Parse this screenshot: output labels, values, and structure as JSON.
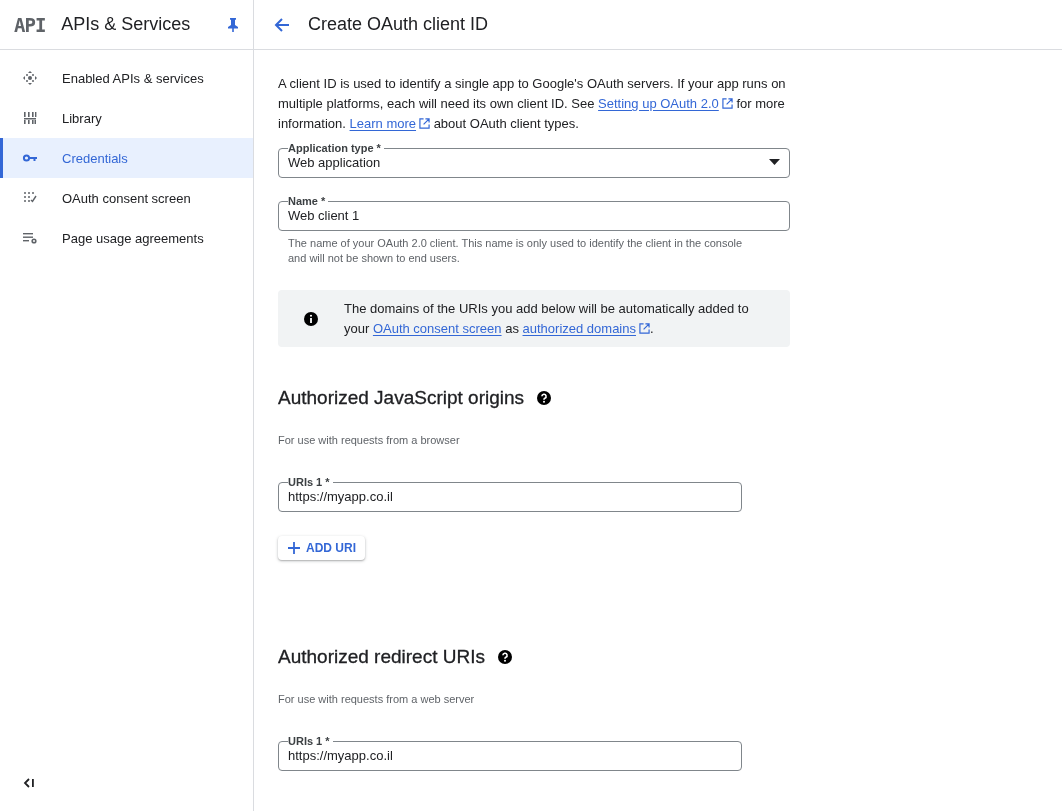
{
  "product": {
    "logo": "API",
    "title": "APIs & Services"
  },
  "sidebar": {
    "items": [
      {
        "label": "Enabled APIs & services",
        "selected": false
      },
      {
        "label": "Library",
        "selected": false
      },
      {
        "label": "Credentials",
        "selected": true
      },
      {
        "label": "OAuth consent screen",
        "selected": false
      },
      {
        "label": "Page usage agreements",
        "selected": false
      }
    ]
  },
  "page": {
    "title": "Create OAuth client ID"
  },
  "intro": [
    {
      "kind": "text",
      "text": "A client ID is used to identify a single app to Google's OAuth servers. If your app runs on multiple platforms, each will need its own client ID. See "
    },
    {
      "kind": "link",
      "text": "Setting up OAuth 2.0",
      "external": true
    },
    {
      "kind": "text",
      "text": " for more information. "
    },
    {
      "kind": "link",
      "text": "Learn more",
      "external": true
    },
    {
      "kind": "text",
      "text": " about OAuth client types."
    }
  ],
  "fields": [
    {
      "kind": "select",
      "label": "Application type *",
      "value": "Web application"
    },
    {
      "kind": "text",
      "label": "Name *",
      "value": "Web client 1",
      "hint": "The name of your OAuth 2.0 client. This name is only used to identify the client in the console and will not be shown to end users."
    }
  ],
  "notice": [
    {
      "kind": "text",
      "text": "The domains of the URIs you add below will be automatically added to your "
    },
    {
      "kind": "link",
      "text": "OAuth consent screen",
      "external": false
    },
    {
      "kind": "text",
      "text": " as "
    },
    {
      "kind": "link",
      "text": "authorized domains",
      "external": true
    },
    {
      "kind": "text",
      "text": "."
    }
  ],
  "sections": [
    {
      "title": "Authorized JavaScript origins",
      "subtitle": "For use with requests from a browser",
      "uris": [
        {
          "label": "URIs 1 *",
          "value": "https://myapp.co.il"
        }
      ],
      "button": "ADD URI"
    },
    {
      "title": "Authorized redirect URIs",
      "subtitle": "For use with requests from a web server",
      "uris": [
        {
          "label": "URIs 1 *",
          "value": "https://myapp.co.il"
        }
      ]
    }
  ]
}
